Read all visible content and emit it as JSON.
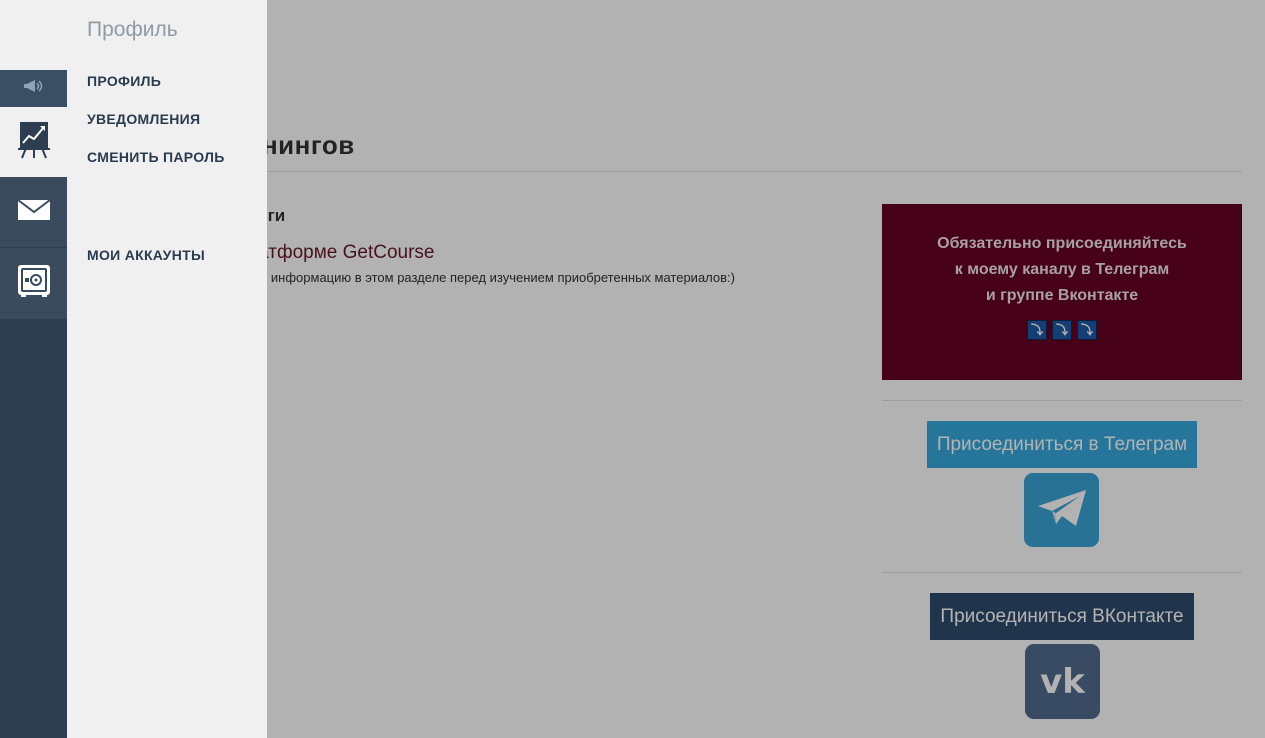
{
  "panel": {
    "title": "Профиль",
    "items": [
      {
        "label": "ПРОФИЛЬ"
      },
      {
        "label": "УВЕДОМЛЕНИЯ"
      },
      {
        "label": "СМЕНИТЬ ПАРОЛЬ"
      },
      {
        "label": "МОИ АККАУНТЫ"
      }
    ]
  },
  "page": {
    "heading": "енингов",
    "section_title": "инги",
    "training_title": "латформе GetCourse",
    "training_description": "ите информацию в этом разделе перед изучением приобретенных материалов:)"
  },
  "promo": {
    "line1": "Обязательно присоединяйтесь",
    "line2": "к моему каналу в Телеграм",
    "line3": "и группе Вконтакте",
    "arrow_glyph": "⤵"
  },
  "social": {
    "telegram_button": "Присоединиться в Телеграм",
    "vk_button": "Присоединиться ВКонтакте",
    "vk_logo_text": "vk"
  },
  "colors": {
    "rail": "#2e3e51",
    "panel": "#f0f0f0",
    "promo_bg": "#650021",
    "telegram": "#37a9e0",
    "vk_button": "#2e4d6c"
  },
  "icons": {
    "rail": [
      "megaphone-icon",
      "chart-board-icon",
      "mail-icon",
      "safe-icon"
    ],
    "telegram_logo": "telegram-plane-icon",
    "vk_logo": "vk-logo-icon"
  }
}
